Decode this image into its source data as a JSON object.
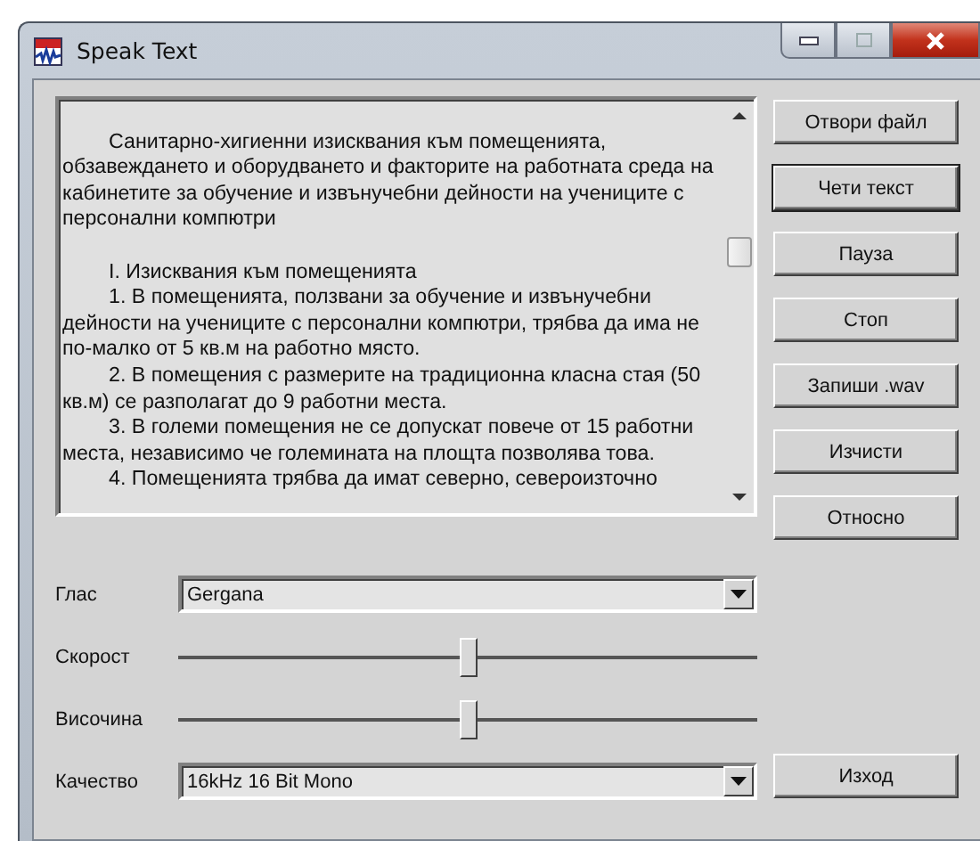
{
  "window": {
    "title": "Speak Text"
  },
  "text": {
    "sections": [
      {
        "paragraphs": [
          "Санитарно-хигиенни изисквания към помещенията, обзавеждането и оборудването и факторите на работната среда на кабинетите за обучение и извънучебни дейности на учениците с персонални компютри"
        ]
      },
      {
        "paragraphs": [
          "I. Изисквания към помещенията",
          "1. В помещенията, ползвани за обучение и извънучебни дейности на учениците с персонални компютри, трябва да има не по-малко от 5 кв.м на работно място.",
          "2. В помещения с размерите на традиционна класна стая (50 кв.м) се разполагат до 9 работни места.",
          "3. В големи помещения не се допускат повече от 15 работни места, независимо че големината на площта позволява това.",
          "4. Помещенията трябва да имат северно, североизточно"
        ]
      }
    ]
  },
  "buttons": [
    {
      "label": "Отвори файл",
      "default": false
    },
    {
      "label": "Чети текст",
      "default": true
    },
    {
      "label": "Пауза",
      "default": false
    },
    {
      "label": "Стоп",
      "default": false
    },
    {
      "label": "Запиши .wav",
      "default": false
    },
    {
      "label": "Изчисти",
      "default": false
    },
    {
      "label": "Относно",
      "default": false
    }
  ],
  "controls": [
    {
      "kind": "combo",
      "label": "Глас",
      "value": "Gergana"
    },
    {
      "kind": "slider",
      "label": "Скорост",
      "level": 0.5
    },
    {
      "kind": "slider",
      "label": "Височина",
      "level": 0.5
    },
    {
      "kind": "combo",
      "label": "Качество",
      "value": "16kHz 16 Bit Mono"
    }
  ],
  "exit_button": "Изход"
}
